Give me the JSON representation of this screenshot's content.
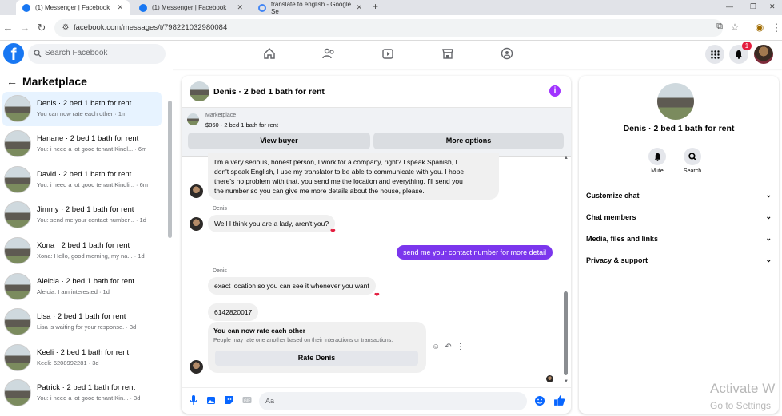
{
  "browser": {
    "tabs": [
      {
        "title": "(1) Messenger | Facebook"
      },
      {
        "title": "(1) Messenger | Facebook"
      },
      {
        "title": "translate to english - Google Se"
      }
    ],
    "url": "facebook.com/messages/t/798221032980084"
  },
  "header": {
    "search_placeholder": "Search Facebook",
    "notification_count": "1"
  },
  "sidebar": {
    "title": "Marketplace",
    "conversations": [
      {
        "name": "Denis · 2 bed 1 bath for rent",
        "preview": "You can now rate each other · 1m"
      },
      {
        "name": "Hanane · 2 bed 1 bath for rent",
        "preview": "You: i need a lot good tenant Kindl... · 6m"
      },
      {
        "name": "David · 2 bed 1 bath for rent",
        "preview": "You: i need a lot good tenant Kindli... · 6m"
      },
      {
        "name": "Jimmy · 2 bed 1 bath for rent",
        "preview": "You: send me your contact number... · 1d"
      },
      {
        "name": "Xona · 2 bed 1 bath for rent",
        "preview": "Xona: Hello, good morning, my na... · 1d"
      },
      {
        "name": "Aleicia · 2 bed 1 bath for rent",
        "preview": "Aleicia: I am interested · 1d"
      },
      {
        "name": "Lisa · 2 bed 1 bath for rent",
        "preview": "Lisa is waiting for your response. · 3d"
      },
      {
        "name": "Keeli · 2 bed 1 bath for rent",
        "preview": "Keeli: 6208992281 · 3d"
      },
      {
        "name": "Patrick · 2 bed 1 bath for rent",
        "preview": "You: i need a lot good tenant Kin... · 3d"
      }
    ]
  },
  "chat": {
    "title": "Denis · 2 bed 1 bath for rent",
    "marketplace_label": "Marketplace",
    "listing": "$860 - 2 bed 1 bath for rent",
    "view_buyer": "View buyer",
    "more_options": "More options",
    "messages": {
      "m1_lines": [
        "I'm a very serious, honest person, I work for a company, right? I speak Spanish, I",
        "don't speak English, I use my translator to be able to communicate with you. I hope",
        "there's no problem with that, you send me the location and everything, I'll send you",
        "the number so you can give me more details about the house, please."
      ],
      "sender1": "Denis",
      "m2": "Well I think you are a lady, aren't you?",
      "m3_out": "send me your contact number for more detail",
      "sender2": "Denis",
      "m4": "exact location so you can see it whenever you want",
      "m5": "6142820017"
    },
    "rate_title": "You can now rate each other",
    "rate_sub": "People may rate one another based on their interactions or transactions.",
    "rate_button": "Rate Denis",
    "composer_placeholder": "Aa"
  },
  "info": {
    "name": "Denis · 2 bed 1 bath for rent",
    "mute": "Mute",
    "search": "Search",
    "rows": [
      "Customize chat",
      "Chat members",
      "Media, files and links",
      "Privacy & support"
    ]
  },
  "watermark": {
    "line1": "Activate W",
    "line2": "Go to Settings"
  }
}
